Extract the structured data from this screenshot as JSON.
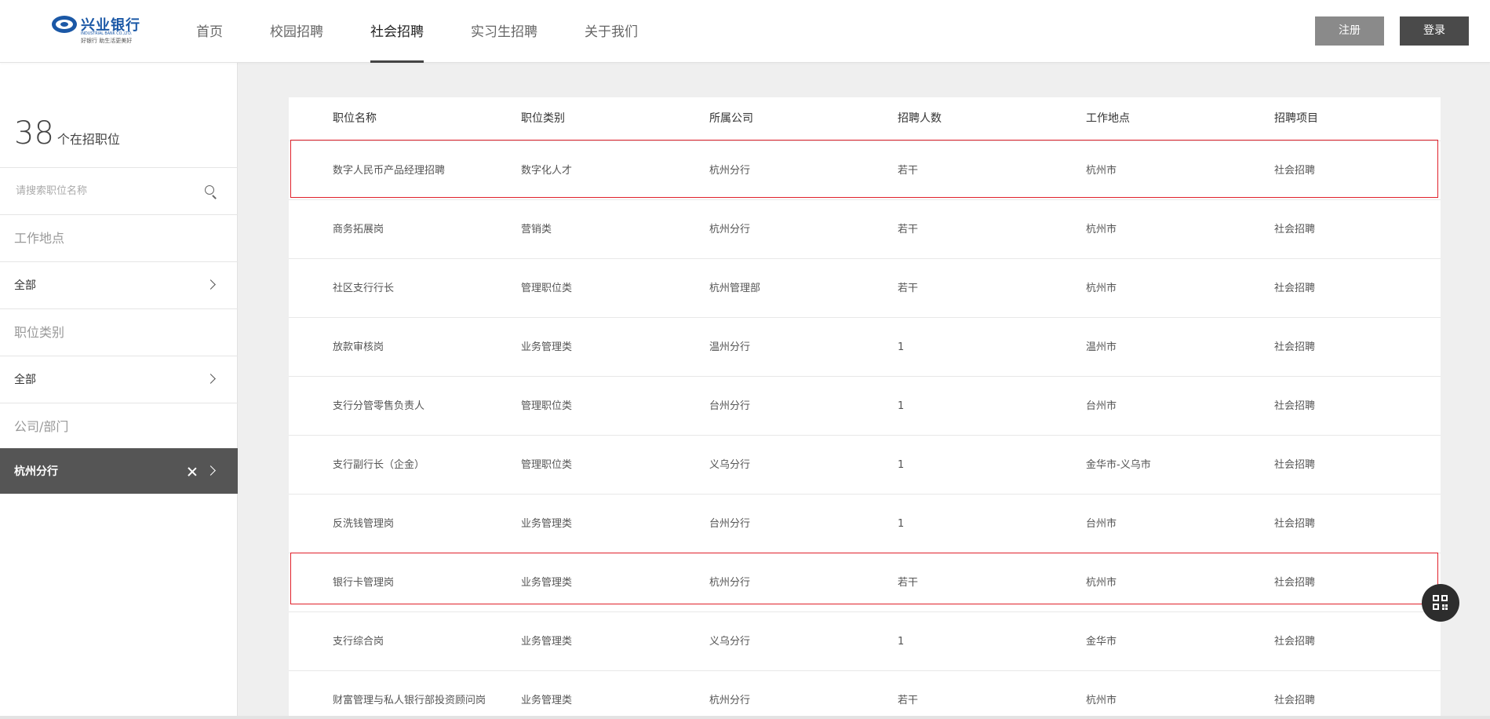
{
  "logo": {
    "name": "兴业银行",
    "en": "INDUSTRIAL BANK CO.,LTD.",
    "slogan": "好银行 助生活更美好"
  },
  "nav": {
    "items": [
      {
        "label": "首页"
      },
      {
        "label": "校园招聘"
      },
      {
        "label": "社会招聘",
        "active": true
      },
      {
        "label": "实习生招聘"
      },
      {
        "label": "关于我们"
      }
    ]
  },
  "header": {
    "register": "注册",
    "login": "登录"
  },
  "sidebar": {
    "count_number": "38",
    "count_label": "个在招职位",
    "search_placeholder": "请搜索职位名称",
    "work_location_label": "工作地点",
    "work_location_value": "全部",
    "job_category_label": "职位类别",
    "job_category_value": "全部",
    "company_label": "公司/部门",
    "company_value": "杭州分行"
  },
  "table": {
    "headers": [
      "职位名称",
      "职位类别",
      "所属公司",
      "招聘人数",
      "工作地点",
      "招聘项目"
    ],
    "rows": [
      [
        "数字人民币产品经理招聘",
        "数字化人才",
        "杭州分行",
        "若干",
        "杭州市",
        "社会招聘"
      ],
      [
        "商务拓展岗",
        "营销类",
        "杭州分行",
        "若干",
        "杭州市",
        "社会招聘"
      ],
      [
        "社区支行行长",
        "管理职位类",
        "杭州管理部",
        "若干",
        "杭州市",
        "社会招聘"
      ],
      [
        "放款审核岗",
        "业务管理类",
        "温州分行",
        "1",
        "温州市",
        "社会招聘"
      ],
      [
        "支行分管零售负责人",
        "管理职位类",
        "台州分行",
        "1",
        "台州市",
        "社会招聘"
      ],
      [
        "支行副行长（企金）",
        "管理职位类",
        "义乌分行",
        "1",
        "金华市-义乌市",
        "社会招聘"
      ],
      [
        "反洗钱管理岗",
        "业务管理类",
        "台州分行",
        "1",
        "台州市",
        "社会招聘"
      ],
      [
        "银行卡管理岗",
        "业务管理类",
        "杭州分行",
        "若干",
        "杭州市",
        "社会招聘"
      ],
      [
        "支行综合岗",
        "业务管理类",
        "义乌分行",
        "1",
        "金华市",
        "社会招聘"
      ],
      [
        "财富管理与私人银行部投资顾问岗",
        "业务管理类",
        "杭州分行",
        "若干",
        "杭州市",
        "社会招聘"
      ]
    ]
  },
  "colors": {
    "highlight": "#e0202a",
    "brand": "#1b58a6",
    "selected_bg": "#555555"
  },
  "icons": {
    "search": "search-icon",
    "chevron": "chevron-right-icon",
    "close": "close-icon",
    "qr": "qr-code-icon"
  }
}
